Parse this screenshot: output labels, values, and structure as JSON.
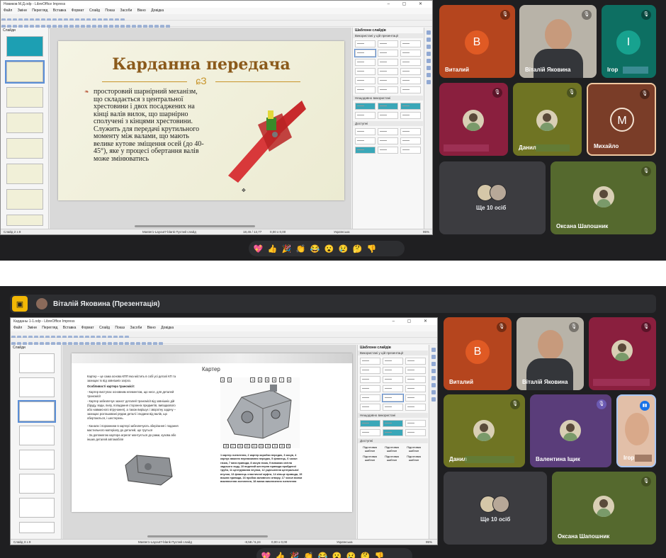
{
  "panel1": {
    "window_title": "Новиков М.Д.odp - LibreOffice Impress",
    "menu": [
      "Файл",
      "Зміни",
      "Перегляд",
      "Вставка",
      "Формат",
      "Слайд",
      "Показ",
      "Засоби",
      "Вікно",
      "Довідка"
    ],
    "slides_label": "Слайди",
    "slide_title": "Карданна передача",
    "slide_ornament": "ɕЗ",
    "slide_text": "просторовий шарнірний механізм, що складається з центральної хрестовини і двох посаджених на кінці валів вилок, що шарнірно сполучені з кінцями хрестовини. Служить для передачі крутильного моменту між валами, що мають велике кутове зміщення осей (до 40-45°), яке у процесі обертання валів може змінюватись",
    "sidebar": {
      "header": "Шаблони слайдів",
      "used": "Використані у цій презентації",
      "recent": "Нещодавно використані",
      "available": "Доступні"
    },
    "status": {
      "slide": "Слайд 2 з 8",
      "layout": "Master1-Layout7-blank Пустий слайд",
      "pos": "18,45 / 13,77",
      "size": "0,00 x 0,00",
      "lang": "Українська",
      "zoom": "95%"
    },
    "tiles": [
      {
        "name": "Виталий",
        "initial": "В",
        "color": "#b03a1c"
      },
      {
        "name": "Віталій Яковина"
      },
      {
        "name": "Ігор",
        "initial": "І",
        "color": "#0d6f62"
      },
      {
        "name": ""
      },
      {
        "name": "Данил"
      },
      {
        "name": "Михайло",
        "initial": "М",
        "color": "#7a3d28"
      },
      {
        "name": "Ще 10 осіб"
      },
      {
        "name": "Оксана Шапошник"
      }
    ]
  },
  "panel2": {
    "presenter": "Віталій Яковина (Презентація)",
    "window_title": "Карданы 1-1.odp - LibreOffice Impress",
    "menu": [
      "Файл",
      "Зміни",
      "Перегляд",
      "Вставка",
      "Формат",
      "Слайд",
      "Показ",
      "Засоби",
      "Вікно",
      "Довідка"
    ],
    "slides_label": "Слайди",
    "slide_title": "Картер",
    "slide_paragraphs": [
      "Картер – це сама основа КПП яка містить в собі усі деталі КП та захищає їх від зовнішніх загроз.",
      "Особливості картера трансмісії:",
      "- Картер виступає основним елементом, що несе, для деталей трансмісії",
      "- Картер забезпечує захист деталей трансмісії від зовнішніх дій (бруду, води, пилу, попадання сторонніх предметів, випадкового або навмисного втручання), а також вирішує і зворотну задачу – захищає розташовані рядом деталі і людини від валів, що обертаються, і шестерень.",
      "- Канали і порожнини в картері забезпечують зберігання і подання мастильного матеріалу до деталей, що труться",
      "- За допомогою картера агрегат монтується до рами, кузова або інших деталей автомобіля"
    ],
    "caption": "1 картер зчеплення, 2 картер коробки передач, 3 засув, 4 корпус важеля перемикання передач, 5 фланець, 6 чохол гачка, 7 вага привода, 8 засув гачка, 9 вимикач світла заднього ходу, 10 ведений шестерня привода пройденої труби, 11 центрування втулки, 12 ущільнення центральної втулки, 13 фланець еластичної муфти, 14 кільце привода, 15 вишня привода, 16 пробка заливного отвору, 17 чохол вилки виключення зчеплення, 18 вилка виключення зчеплення",
    "callouts": [
      "1",
      "2",
      "3",
      "4",
      "5",
      "6",
      "7",
      "8"
    ],
    "callouts_bottom": [
      "18",
      "17",
      "16",
      "15",
      "14",
      "13",
      "12",
      "11",
      "10",
      "9"
    ],
    "sidebar": {
      "header": "Шаблони слайдів",
      "used": "Використані у цій презентації",
      "recent": "Нещодавно використані",
      "available": "Доступні",
      "item": "Підготовка шаблон"
    },
    "status": {
      "slide": "Слайд 3 з 9",
      "layout": "Master1-Layout7-blank Пустий слайд",
      "pos": "-8,58 / 5,24",
      "size": "0,00 x 0,00",
      "lang": "Українська",
      "zoom": "95%"
    },
    "tiles": [
      {
        "name": "Виталий",
        "initial": "В",
        "color": "#b03a1c"
      },
      {
        "name": "Віталій Яковина"
      },
      {
        "name": ""
      },
      {
        "name": "Данил"
      },
      {
        "name": "Валентина Іщик"
      },
      {
        "name": "Ігор"
      },
      {
        "name": "Ще 10 осіб"
      },
      {
        "name": "Оксана Шапошник"
      }
    ]
  },
  "reactions": [
    "💖",
    "👍",
    "🎉",
    "👏",
    "😂",
    "😮",
    "😢",
    "🤔",
    "👎"
  ]
}
